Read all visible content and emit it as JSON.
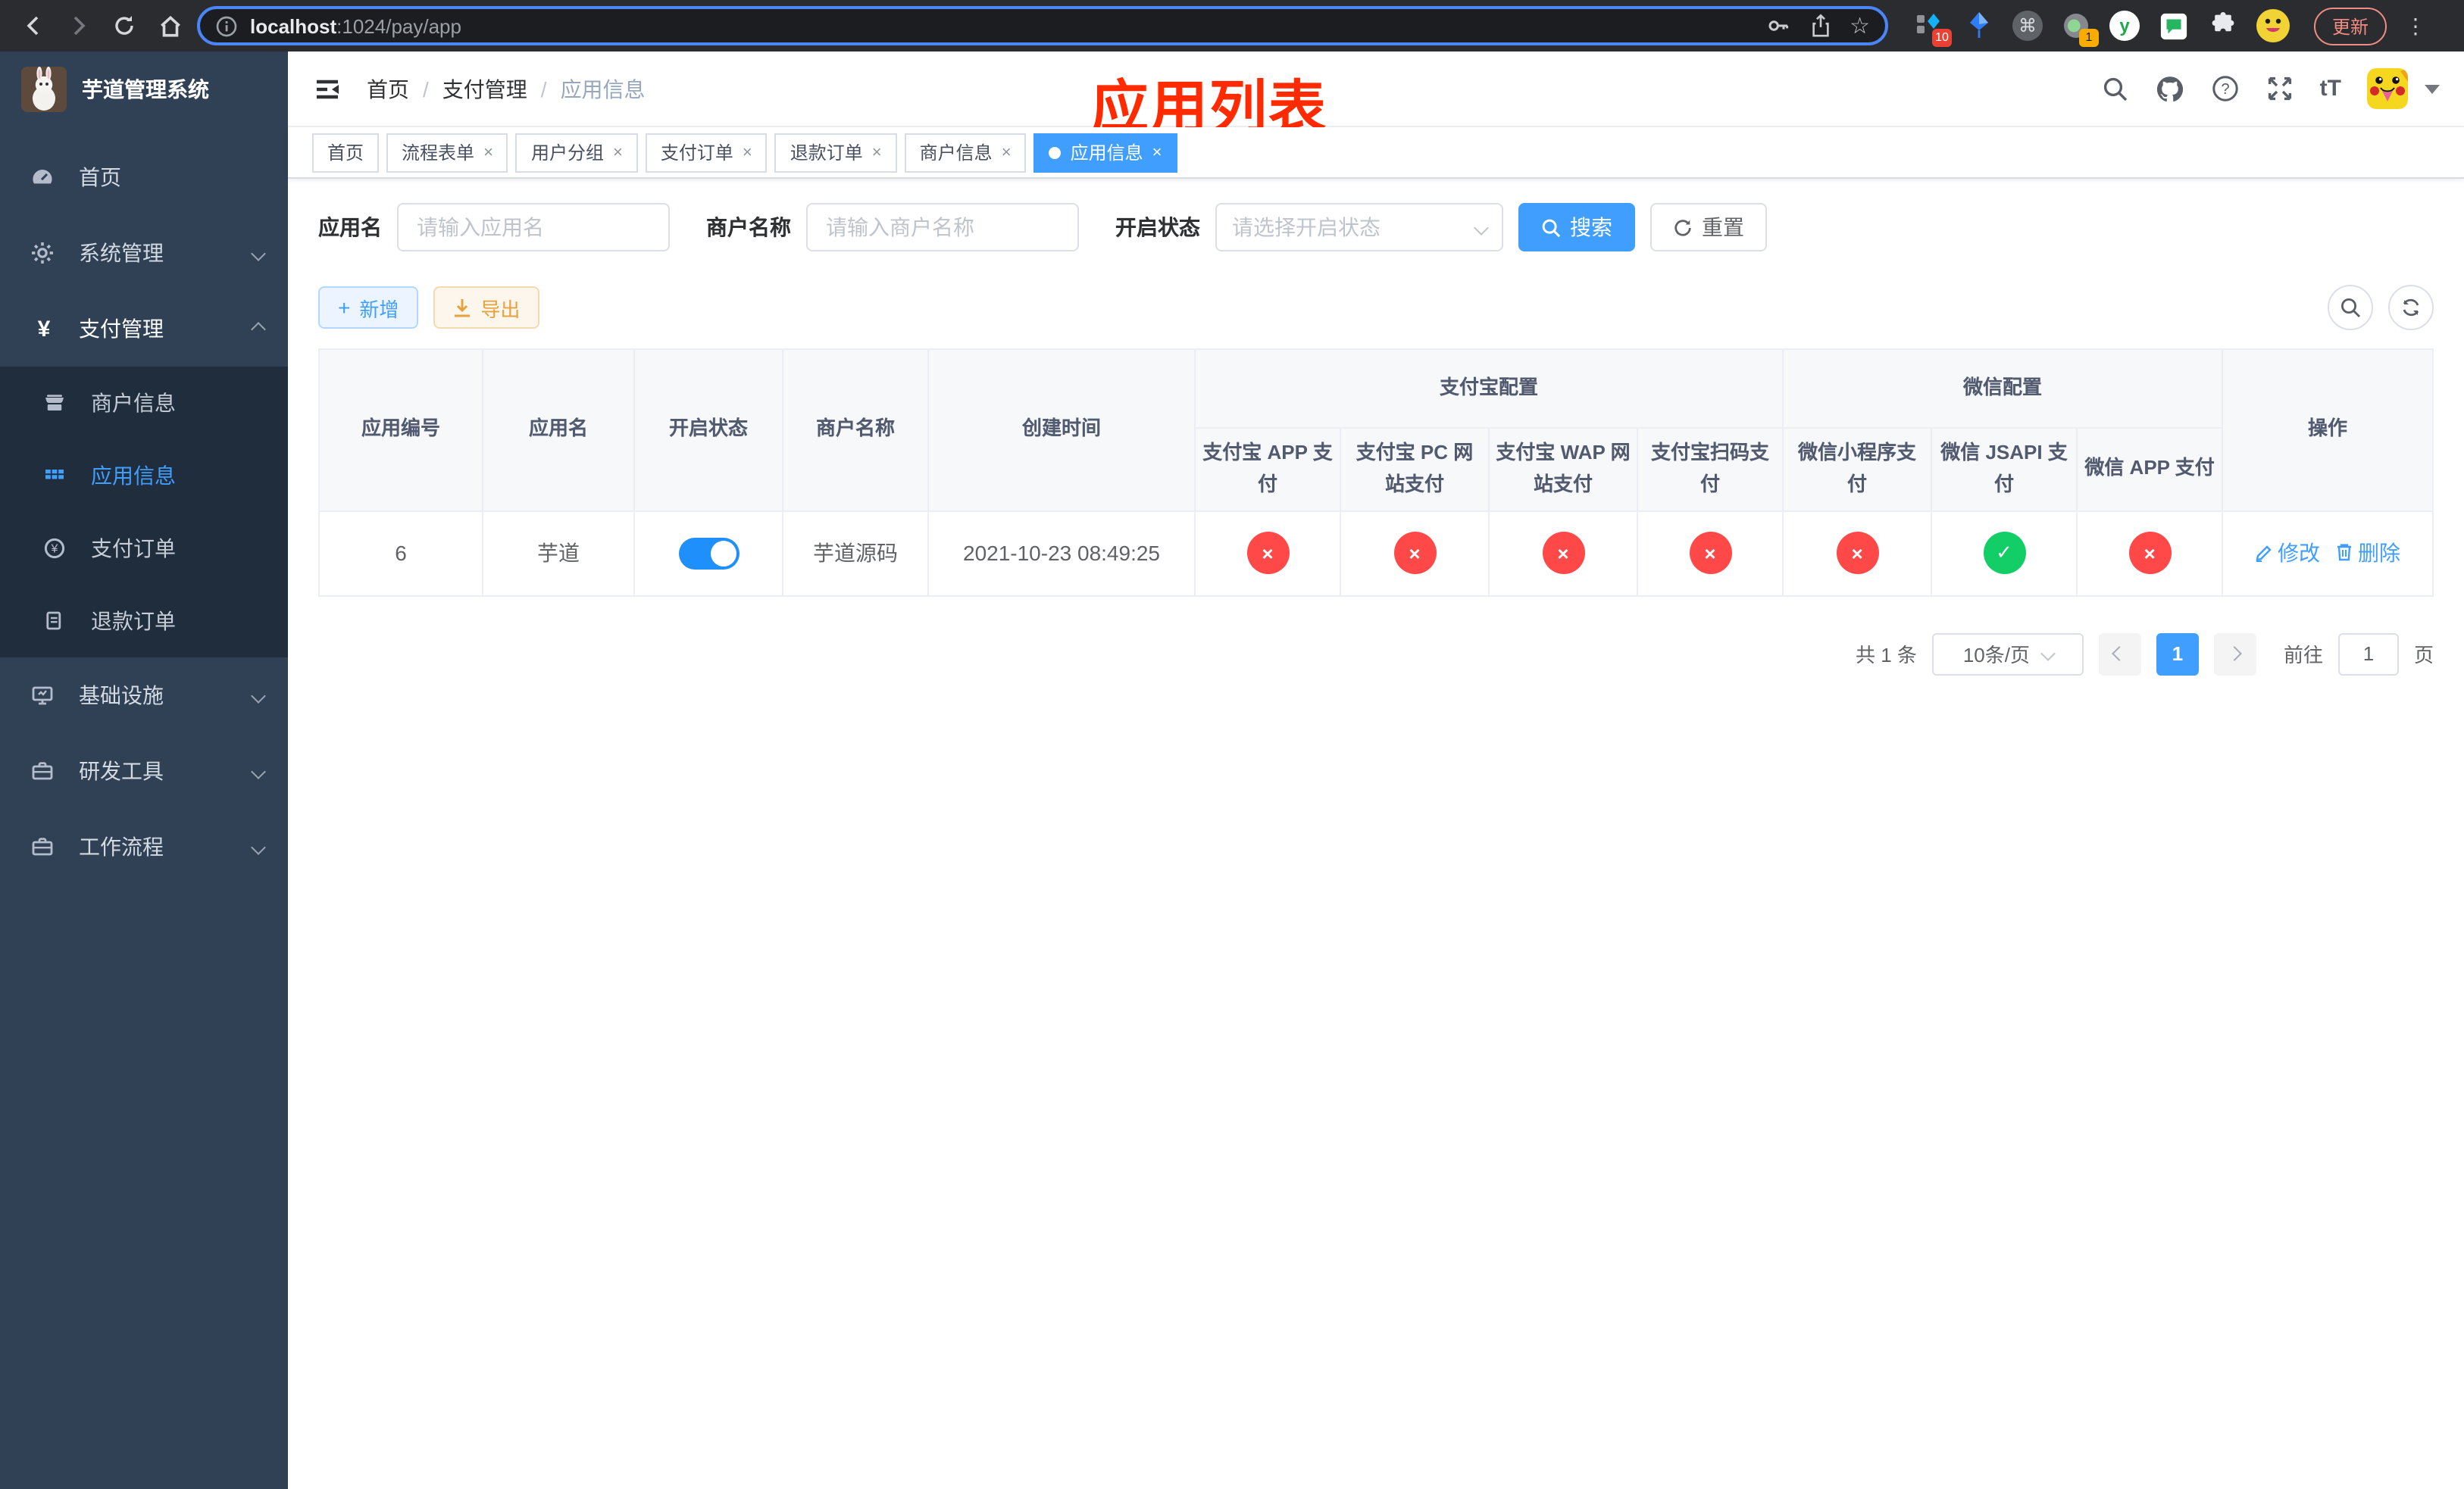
{
  "icons": {
    "close": "×",
    "check": "✓",
    "cross": "×",
    "plus": "+",
    "command": "⌘",
    "dots": "⋮",
    "smile": "☺",
    "yen": "¥",
    "question": "?",
    "fontsize": "tT",
    "star": "☆",
    "info": "i",
    "y_logo": "y",
    "page_current": "1"
  },
  "colors": {
    "accent": "#409eff",
    "success": "#13ce66",
    "danger": "#ff4949",
    "warning": "#e6a23c",
    "sidebar_bg": "#304156",
    "submenu_bg": "#1f2d3d",
    "annotation_red": "#ff2a00",
    "switch_on": "#1f8ffb"
  },
  "browser": {
    "url_host": "localhost",
    "url_path": ":1024/pay/app",
    "badge_red": "10",
    "badge_orange": "1",
    "update_button": "更新"
  },
  "sidebar": {
    "logo_title": "芋道管理系统",
    "menu_home": "首页",
    "menu_system": "系统管理",
    "menu_pay": "支付管理",
    "sub_merchant": "商户信息",
    "sub_app": "应用信息",
    "sub_pay_order": "支付订单",
    "sub_refund_order": "退款订单",
    "menu_infra": "基础设施",
    "menu_dev": "研发工具",
    "menu_workflow": "工作流程"
  },
  "navbar": {
    "breadcrumb_home": "首页",
    "breadcrumb_sep": "/",
    "breadcrumb_level1": "支付管理",
    "breadcrumb_current": "应用信息",
    "annotation": "应用列表"
  },
  "tabs": {
    "items": [
      {
        "label": "首页"
      },
      {
        "label": "流程表单"
      },
      {
        "label": "用户分组"
      },
      {
        "label": "支付订单"
      },
      {
        "label": "退款订单"
      },
      {
        "label": "商户信息"
      },
      {
        "label": "应用信息"
      }
    ]
  },
  "filters": {
    "app_name_label": "应用名",
    "app_name_placeholder": "请输入应用名",
    "merchant_label": "商户名称",
    "merchant_placeholder": "请输入商户名称",
    "status_label": "开启状态",
    "status_placeholder": "请选择开启状态",
    "search_button": "搜索",
    "reset_button": "重置"
  },
  "toolbar": {
    "add_button": "新增",
    "export_button": "导出"
  },
  "table": {
    "h_app_id": "应用编号",
    "h_app_name": "应用名",
    "h_status": "开启状态",
    "h_merchant": "商户名称",
    "h_created": "创建时间",
    "g_alipay": "支付宝配置",
    "g_wechat": "微信配置",
    "h_op": "操作",
    "h_alipay_app": "支付宝 APP 支付",
    "h_alipay_pc": "支付宝 PC 网站支付",
    "h_alipay_wap": "支付宝 WAP 网站支付",
    "h_alipay_scan": "支付宝扫码支付",
    "h_wx_mini": "微信小程序支付",
    "h_wx_jsapi": "微信 JSAPI 支付",
    "h_wx_app": "微信 APP 支付",
    "row": {
      "app_id": "6",
      "app_name": "芋道",
      "status_on": true,
      "merchant": "芋道源码",
      "created": "2021-10-23 08:49:25",
      "channel_status": [
        "no",
        "no",
        "no",
        "no",
        "no",
        "yes",
        "no"
      ],
      "edit": "修改",
      "delete": "删除"
    }
  },
  "pagination": {
    "total": "共 1 条",
    "page_size": "10条/页",
    "page": "1",
    "goto_prefix": "前往",
    "goto_value": "1",
    "goto_suffix": "页"
  }
}
